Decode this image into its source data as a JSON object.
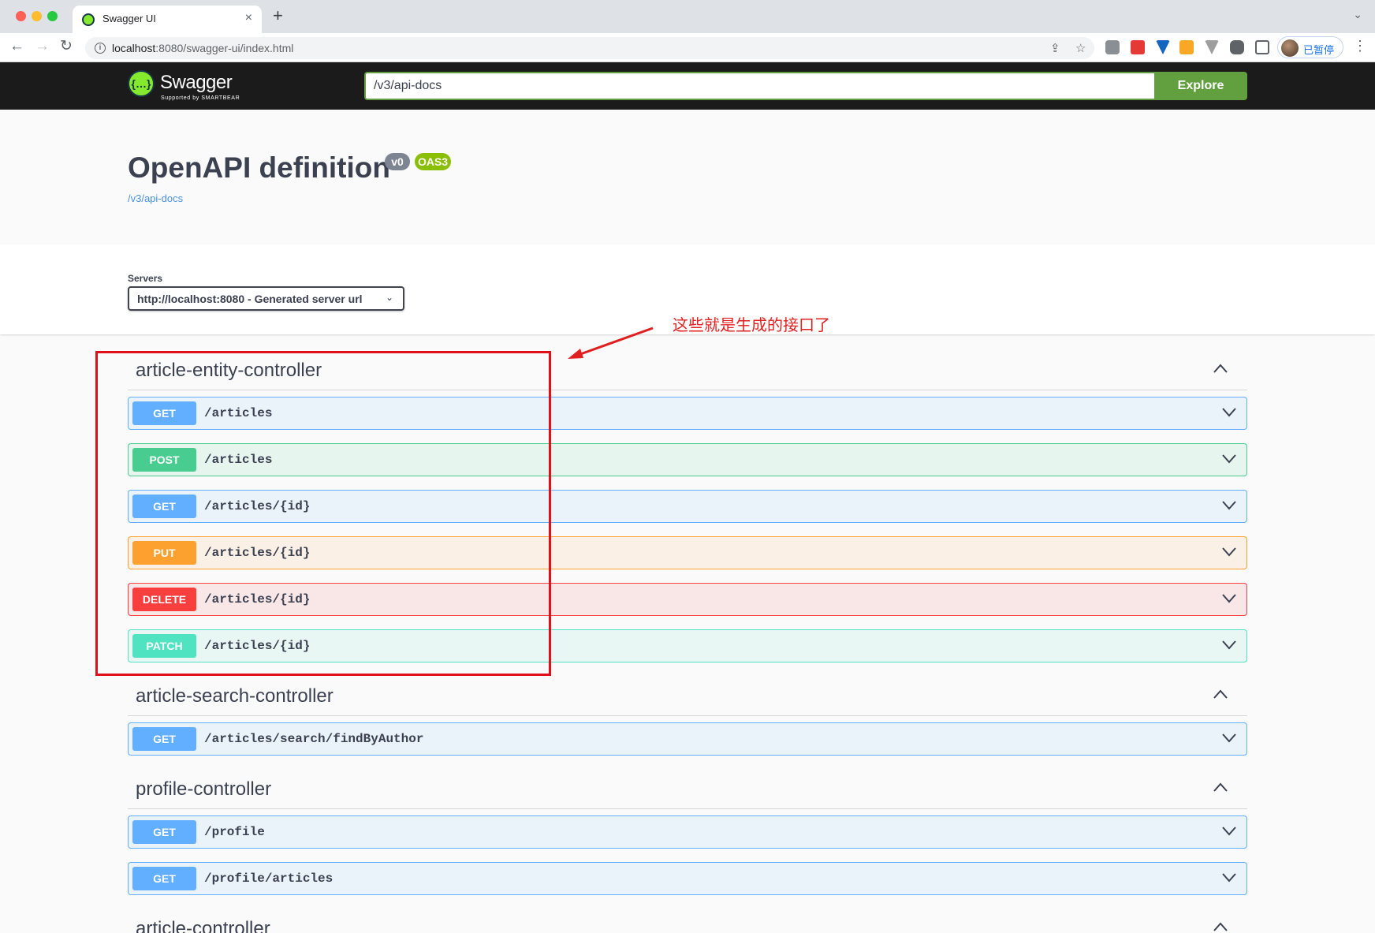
{
  "browser": {
    "tab_title": "Swagger UI",
    "tab_close": "×",
    "new_tab": "+",
    "url_host": "localhost",
    "url_rest": ":8080/swagger-ui/index.html",
    "profile_label": "已暂停"
  },
  "topbar": {
    "logo_text": "Swagger",
    "logo_mark": "{…}",
    "logo_subtext": "Supported by SMARTBEAR",
    "url_value": "/v3/api-docs",
    "explore_label": "Explore"
  },
  "info": {
    "title": "OpenAPI definition",
    "version": "v0",
    "oas": "OAS3",
    "link": "/v3/api-docs"
  },
  "servers": {
    "label": "Servers",
    "selected": "http://localhost:8080 - Generated server url"
  },
  "annotation": {
    "text": "这些就是生成的接口了",
    "color": "#e02020"
  },
  "tags": [
    {
      "name": "article-entity-controller",
      "expanded": true
    },
    {
      "name": "article-search-controller",
      "expanded": true
    },
    {
      "name": "profile-controller",
      "expanded": true
    },
    {
      "name": "article-controller",
      "expanded": true
    }
  ],
  "operations": [
    {
      "method": "GET",
      "path": "/articles"
    },
    {
      "method": "POST",
      "path": "/articles"
    },
    {
      "method": "GET",
      "path": "/articles/{id}"
    },
    {
      "method": "PUT",
      "path": "/articles/{id}"
    },
    {
      "method": "DELETE",
      "path": "/articles/{id}"
    },
    {
      "method": "PATCH",
      "path": "/articles/{id}"
    },
    {
      "method": "GET",
      "path": "/articles/search/findByAuthor"
    },
    {
      "method": "GET",
      "path": "/profile"
    },
    {
      "method": "GET",
      "path": "/profile/articles"
    }
  ],
  "colors": {
    "get": "#61affe",
    "post": "#49cc90",
    "put": "#fca130",
    "delete": "#f93e3e",
    "patch": "#50e3c2",
    "explore": "#62a03f",
    "swagger_green": "#85ea2d"
  }
}
